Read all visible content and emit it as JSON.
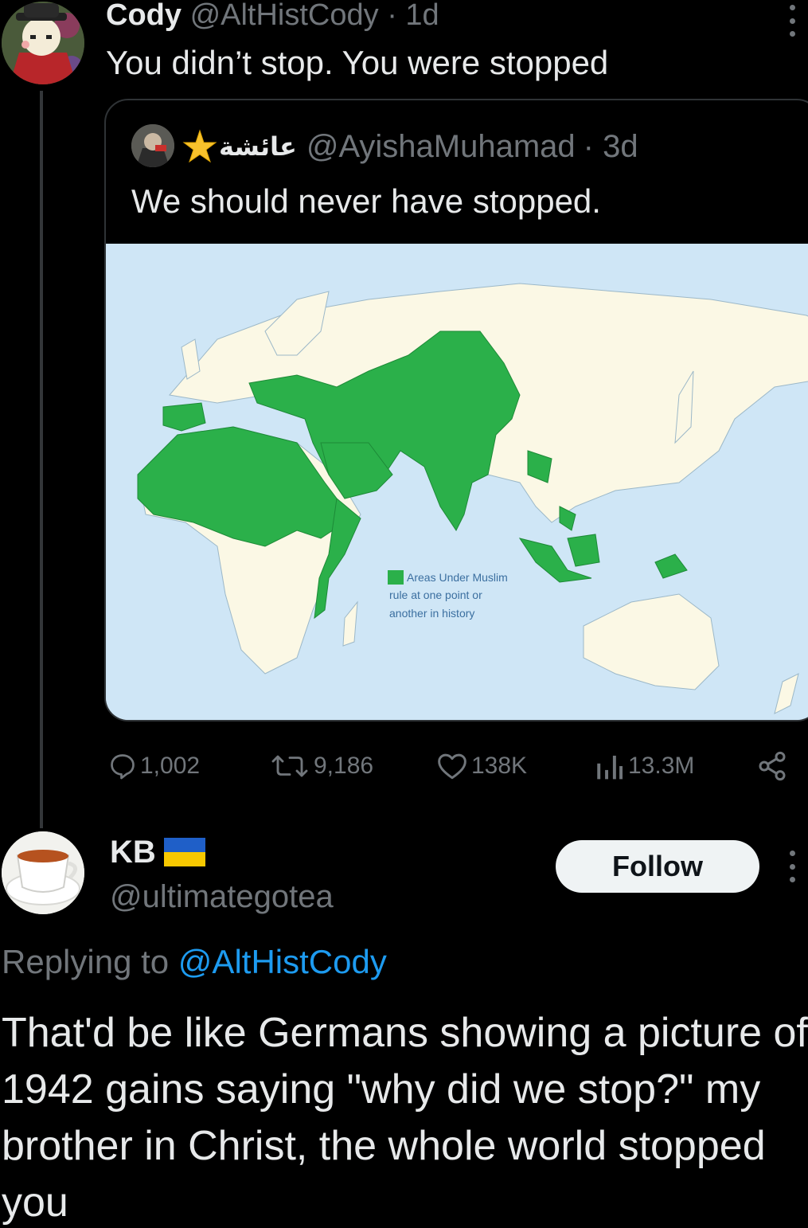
{
  "tweet": {
    "author_name": "Cody",
    "author_handle": "@AltHistCody",
    "time": "· 1d",
    "text": "You didn’t stop. You were stopped"
  },
  "quoted_tweet": {
    "author_name": "عائشة",
    "author_handle": "@AyishaMuhamad",
    "time": "· 3d",
    "text": "We should never have stopped.",
    "map_legend": [
      "Areas Under Muslim",
      "rule at one point or",
      "another in history"
    ],
    "map_colors": {
      "ocean": "#cfe6f6",
      "land": "#fbf8e5",
      "highlighted": "#2bb04a"
    }
  },
  "stats": {
    "replies": "1,002",
    "retweets": "9,186",
    "likes": "138K",
    "views": "13.3M"
  },
  "reply": {
    "author_name": "KB",
    "author_handle": "@ultimategotea",
    "follow_label": "Follow",
    "replying_prefix": "Replying to",
    "replying_mention": "@AltHistCody",
    "text": "That'd be like Germans showing a picture of 1942 gains saying \"why did we stop?\" my brother in Christ, the whole world stopped you"
  }
}
